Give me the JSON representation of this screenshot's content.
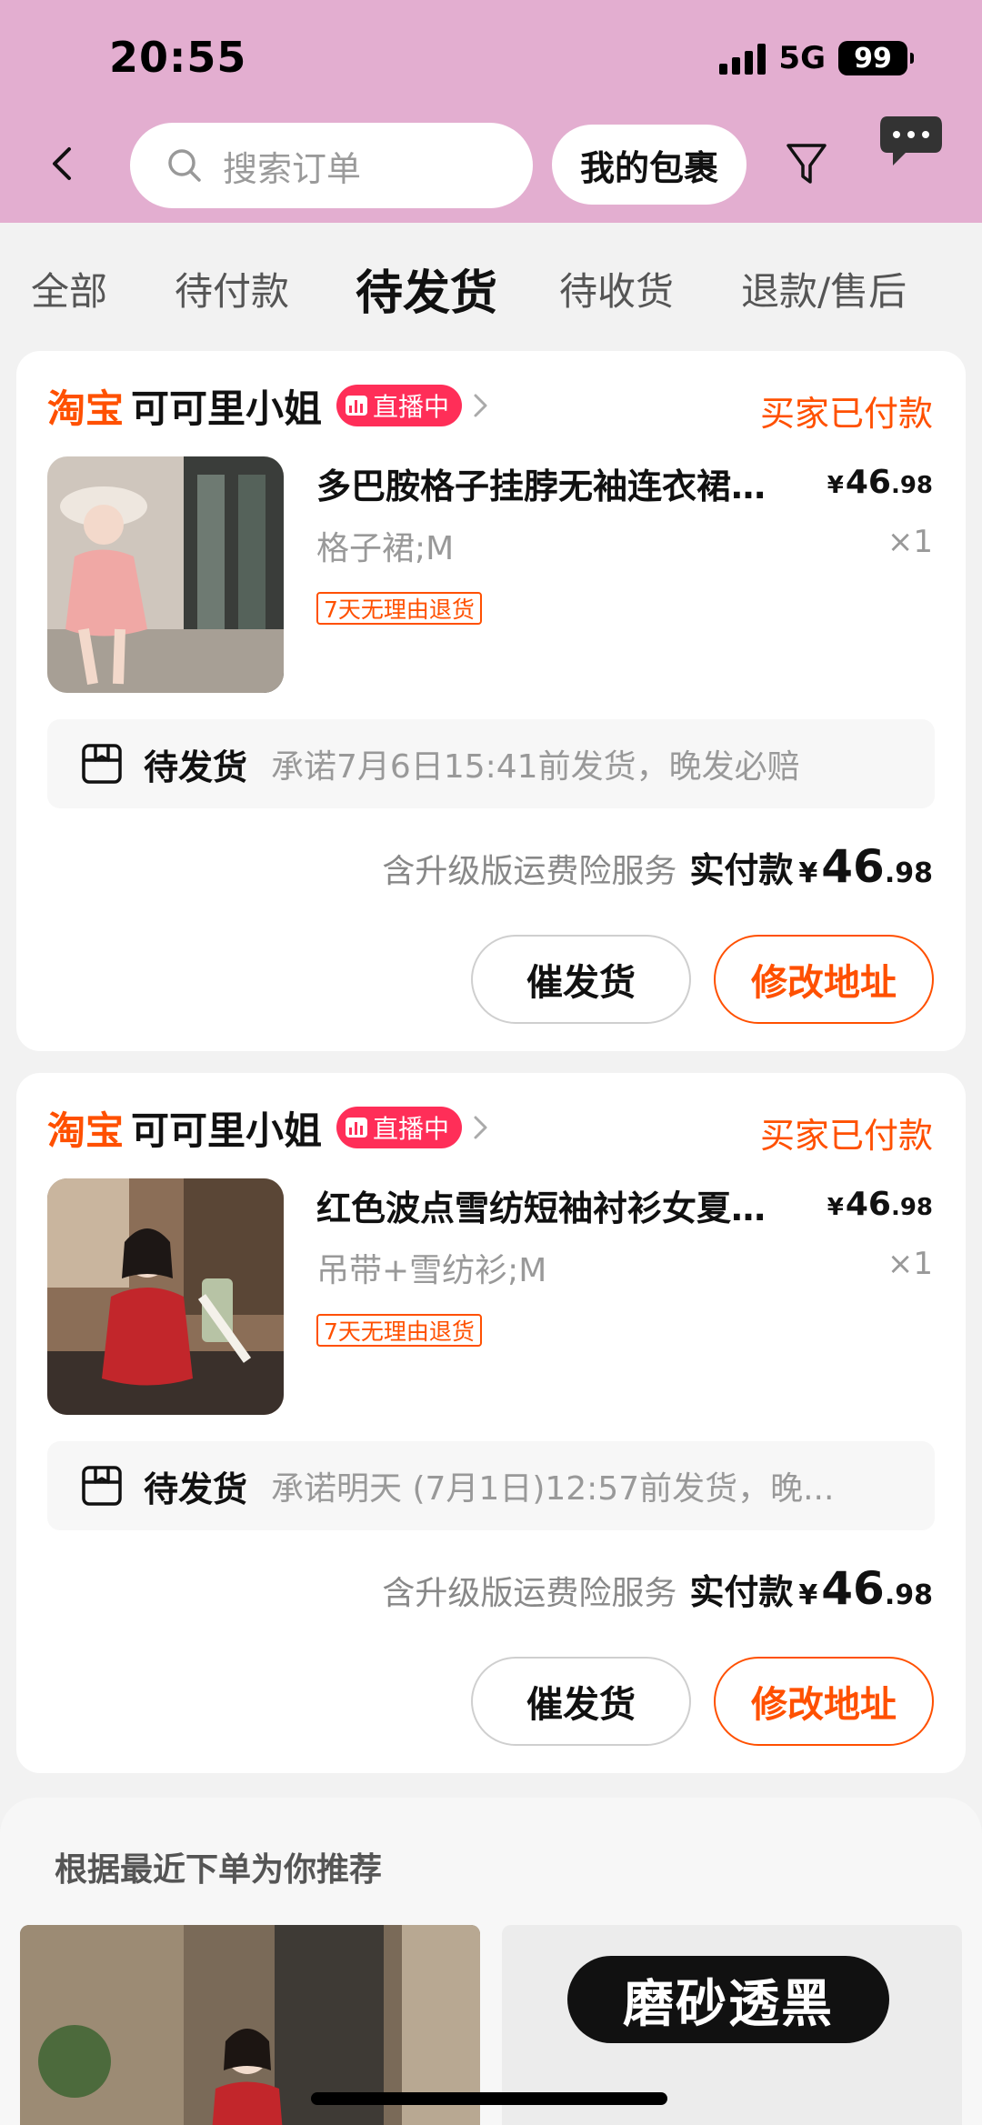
{
  "status_bar": {
    "time": "20:55",
    "network": "5G",
    "battery": "99"
  },
  "header": {
    "search_placeholder": "搜索订单",
    "parcel_button": "我的包裹"
  },
  "tabs": [
    {
      "label": "全部",
      "active": false
    },
    {
      "label": "待付款",
      "active": false
    },
    {
      "label": "待发货",
      "active": true
    },
    {
      "label": "待收货",
      "active": false
    },
    {
      "label": "退款/售后",
      "active": false
    }
  ],
  "orders": [
    {
      "platform": "淘宝",
      "shop": "可可里小姐",
      "live_badge": "直播中",
      "status": "买家已付款",
      "title": "多巴胺格子挂脖无袖连衣裙…",
      "price_symbol": "¥",
      "price_int": "46",
      "price_dec": ".98",
      "sku": "格子裙;M",
      "qty": "×1",
      "tag": "7天无理由退货",
      "ship_label": "待发货",
      "ship_desc": "承诺7月6日15:41前发货，晚发必赔",
      "pay_note": "含升级版运费险服务",
      "pay_label": "实付款",
      "pay_symbol": "¥",
      "pay_int": "46",
      "pay_dec": ".98",
      "btn_urge": "催发货",
      "btn_address": "修改地址"
    },
    {
      "platform": "淘宝",
      "shop": "可可里小姐",
      "live_badge": "直播中",
      "status": "买家已付款",
      "title": "红色波点雪纺短袖衬衫女夏…",
      "price_symbol": "¥",
      "price_int": "46",
      "price_dec": ".98",
      "sku": "吊带+雪纺衫;M",
      "qty": "×1",
      "tag": "7天无理由退货",
      "ship_label": "待发货",
      "ship_desc": "承诺明天 (7月1日)12:57前发货，晚...",
      "pay_note": "含升级版运费险服务",
      "pay_label": "实付款",
      "pay_symbol": "¥",
      "pay_int": "46",
      "pay_dec": ".98",
      "btn_urge": "催发货",
      "btn_address": "修改地址"
    }
  ],
  "recommend": {
    "title": "根据最近下单为你推荐",
    "badge": "磨砂透黑"
  },
  "colors": {
    "header_bg": "#e3aed0",
    "accent": "#ff5000",
    "live": "#ff2e58"
  }
}
